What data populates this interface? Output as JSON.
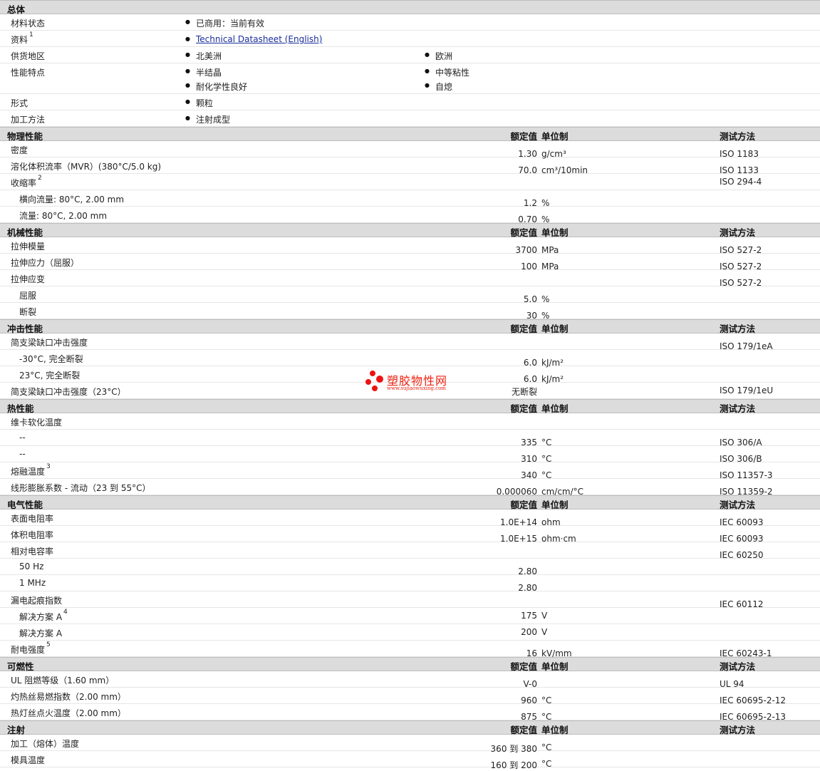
{
  "general": {
    "title": "总体",
    "material_status_label": "材料状态",
    "material_status_value": "已商用：当前有效",
    "docs_label": "资料",
    "docs_sup": "1",
    "docs_link": "Technical Datasheet (English)",
    "region_label": "供货地区",
    "region_1": "北美洲",
    "region_2": "欧洲",
    "features_label": "性能特点",
    "feature_1": "半结晶",
    "feature_2": "中等粘性",
    "feature_3": "耐化学性良好",
    "feature_4": "自熄",
    "form_label": "形式",
    "form_value": "颗粒",
    "process_label": "加工方法",
    "process_value": "注射成型"
  },
  "columns": {
    "value": "额定值",
    "unit": "单位制",
    "method": "测试方法"
  },
  "sections": [
    {
      "title": "物理性能",
      "rows": [
        {
          "label": "密度",
          "value": "1.30",
          "unit": "g/cm³",
          "method": "ISO 1183"
        },
        {
          "label": "溶化体积流率（MVR）(380°C/5.0 kg)",
          "value": "70.0",
          "unit": "cm³/10min",
          "method": "ISO 1133"
        },
        {
          "label": "收缩率",
          "sup": "2",
          "value": "",
          "unit": "",
          "method": "ISO 294-4"
        },
        {
          "label": "横向流量: 80°C, 2.00 mm",
          "value": "1.2",
          "unit": "%",
          "method": ""
        },
        {
          "label": "流量: 80°C, 2.00 mm",
          "value": "0.70",
          "unit": "%",
          "method": ""
        }
      ]
    },
    {
      "title": "机械性能",
      "rows": [
        {
          "label": "拉伸模量",
          "value": "3700",
          "unit": "MPa",
          "method": "ISO 527-2"
        },
        {
          "label": "拉伸应力（屈服）",
          "value": "100",
          "unit": "MPa",
          "method": "ISO 527-2"
        },
        {
          "label": "拉伸应变",
          "value": "",
          "unit": "",
          "method": "ISO 527-2"
        },
        {
          "label": "屈服",
          "value": "5.0",
          "unit": "%",
          "method": ""
        },
        {
          "label": "断裂",
          "value": "30",
          "unit": "%",
          "method": ""
        }
      ]
    },
    {
      "title": "冲击性能",
      "rows": [
        {
          "label": "简支梁缺口冲击强度",
          "value": "",
          "unit": "",
          "method": "ISO 179/1eA"
        },
        {
          "label": "-30°C, 完全断裂",
          "value": "6.0",
          "unit": "kJ/m²",
          "method": ""
        },
        {
          "label": "23°C, 完全断裂",
          "value": "6.0",
          "unit": "kJ/m²",
          "method": ""
        },
        {
          "label": "简支梁缺口冲击强度（23°C）",
          "value": "无断裂",
          "unit": "",
          "method": "ISO 179/1eU"
        }
      ]
    },
    {
      "title": "热性能",
      "rows": [
        {
          "label": "维卡软化温度",
          "value": "",
          "unit": "",
          "method": ""
        },
        {
          "label": "--",
          "value": "335",
          "unit": "°C",
          "method": "ISO 306/A"
        },
        {
          "label": "--",
          "value": "310",
          "unit": "°C",
          "method": "ISO 306/B"
        },
        {
          "label": "熔融温度",
          "sup": "3",
          "value": "340",
          "unit": "°C",
          "method": "ISO 11357-3"
        },
        {
          "label": "线形膨胀系数 - 流动（23 到 55°C）",
          "value": "0.000060",
          "unit": "cm/cm/°C",
          "method": "ISO 11359-2"
        }
      ]
    },
    {
      "title": "电气性能",
      "rows": [
        {
          "label": "表面电阻率",
          "value": "1.0E+14",
          "unit": "ohm",
          "method": "IEC 60093"
        },
        {
          "label": "体积电阻率",
          "value": "1.0E+15",
          "unit": "ohm·cm",
          "method": "IEC 60093"
        },
        {
          "label": "相对电容率",
          "value": "",
          "unit": "",
          "method": "IEC 60250"
        },
        {
          "label": "50 Hz",
          "value": "2.80",
          "unit": "",
          "method": ""
        },
        {
          "label": "1 MHz",
          "value": "2.80",
          "unit": "",
          "method": ""
        },
        {
          "label": "漏电起痕指数",
          "value": "",
          "unit": "",
          "method": "IEC 60112"
        },
        {
          "label": "解决方案 A",
          "sup": "4",
          "value": "175",
          "unit": "V",
          "method": ""
        },
        {
          "label": "解决方案 A",
          "value": "200",
          "unit": "V",
          "method": ""
        },
        {
          "label": "耐电强度",
          "sup": "5",
          "value": "16",
          "unit": "kV/mm",
          "method": "IEC 60243-1"
        }
      ]
    },
    {
      "title": "可燃性",
      "rows": [
        {
          "label": "UL 阻燃等级（1.60 mm）",
          "value": "V-0",
          "unit": "",
          "method": "UL 94"
        },
        {
          "label": "灼热丝易燃指数（2.00 mm）",
          "value": "960",
          "unit": "°C",
          "method": "IEC 60695-2-12"
        },
        {
          "label": "热灯丝点火温度（2.00 mm）",
          "value": "875",
          "unit": "°C",
          "method": "IEC 60695-2-13"
        }
      ]
    },
    {
      "title": "注射",
      "rows": [
        {
          "label": "加工（熔体）温度",
          "value": "360 到 380",
          "unit": "°C",
          "method": ""
        },
        {
          "label": "模具温度",
          "value": "160 到 200",
          "unit": "°C",
          "method": ""
        }
      ]
    }
  ],
  "watermark": {
    "brand": "塑胶物性网",
    "url": "www.sujiaowuxing.com"
  }
}
